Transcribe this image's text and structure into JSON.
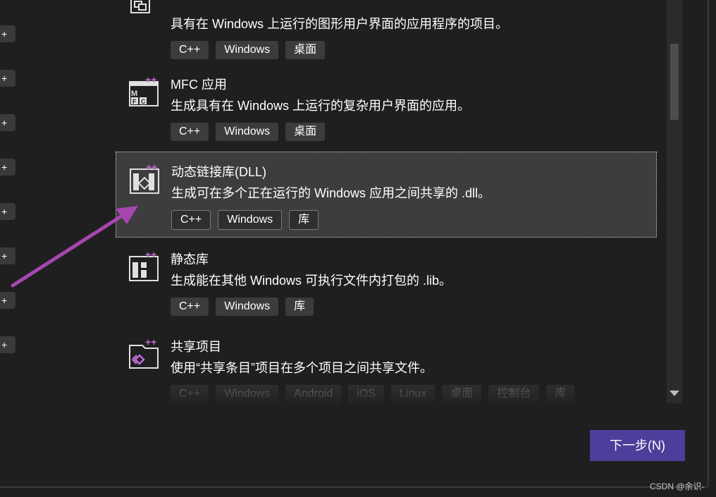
{
  "left_panel": {
    "add_glyph": "+",
    "count": 8
  },
  "templates": [
    {
      "icon": "desktop-app-icon",
      "title": "",
      "description": "具有在 Windows 上运行的图形用户界面的应用程序的项目。",
      "tags": [
        "C++",
        "Windows",
        "桌面"
      ]
    },
    {
      "icon": "mfc-app-icon",
      "title": "MFC 应用",
      "description": "生成具有在 Windows 上运行的复杂用户界面的应用。",
      "tags": [
        "C++",
        "Windows",
        "桌面"
      ]
    },
    {
      "icon": "dll-library-icon",
      "title": "动态链接库(DLL)",
      "description": "生成可在多个正在运行的 Windows 应用之间共享的 .dll。",
      "tags": [
        "C++",
        "Windows",
        "库"
      ],
      "selected": true
    },
    {
      "icon": "static-library-icon",
      "title": "静态库",
      "description": "生成能在其他 Windows 可执行文件内打包的 .lib。",
      "tags": [
        "C++",
        "Windows",
        "库"
      ]
    },
    {
      "icon": "shared-items-icon",
      "title": "共享项目",
      "description": "使用“共享条目”项目在多个项目之间共享文件。",
      "tags": [
        "C++",
        "Windows",
        "Android",
        "iOS",
        "Linux",
        "桌面",
        "控制台",
        "库"
      ]
    }
  ],
  "footer": {
    "next_label": "下一步(N)",
    "watermark": "CSDN @余识-"
  },
  "colors": {
    "background": "#1f1f1f",
    "selected_background": "#3d3d3d",
    "tag_background": "#3c3c3c",
    "accent_button": "#4d3e9c",
    "annotation_arrow": "#a646b0"
  }
}
